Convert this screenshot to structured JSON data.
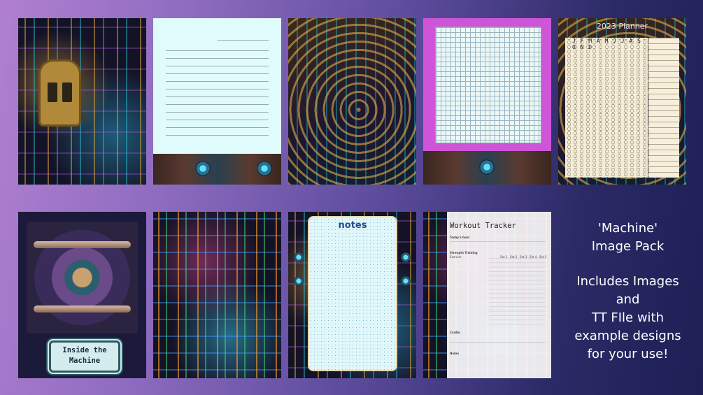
{
  "planner": {
    "title": "2023 Planner",
    "months": "J F M A M J J A S O N D"
  },
  "machine_cover": {
    "label": "Inside the\nMachine"
  },
  "notes_page": {
    "title": "notes"
  },
  "workout_tracker": {
    "title": "Workout Tracker",
    "todays_goal": "Today's Goal",
    "strength_training": "Strength Training",
    "exercise": "Exercise",
    "set_headers": [
      "Set 1",
      "Set 2",
      "Set 3",
      "Set 4",
      "Set 5"
    ],
    "cardio": "Cardio",
    "notes": "Notes"
  },
  "caption": {
    "line1": "'Machine'\nImage Pack",
    "line2": "Includes Images\nand\nTT FIle with\nexample designs\nfor your use!"
  }
}
